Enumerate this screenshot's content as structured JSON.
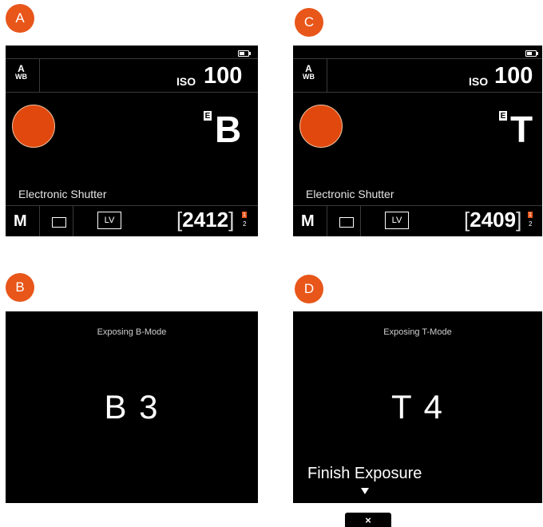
{
  "panels": {
    "A": {
      "badge": "A",
      "wb_top": "A",
      "wb_bottom": "WB",
      "iso_label": "ISO",
      "iso_value": "100",
      "e_marker": "E",
      "mode": "B",
      "shutter_text": "Electronic Shutter",
      "exposure_mode": "M",
      "lv_label": "LV",
      "bracket_open": "[",
      "shot_count": "2412",
      "bracket_close": "]",
      "card_slot_active": "1",
      "card_slot_other": "2"
    },
    "C": {
      "badge": "C",
      "wb_top": "A",
      "wb_bottom": "WB",
      "iso_label": "ISO",
      "iso_value": "100",
      "e_marker": "E",
      "mode": "T",
      "shutter_text": "Electronic Shutter",
      "exposure_mode": "M",
      "lv_label": "LV",
      "bracket_open": "[",
      "shot_count": "2409",
      "bracket_close": "]",
      "card_slot_active": "1",
      "card_slot_other": "2"
    },
    "B": {
      "badge": "B",
      "title": "Exposing B-Mode",
      "readout": "B 3"
    },
    "D": {
      "badge": "D",
      "title": "Exposing T-Mode",
      "readout": "T 4",
      "finish_label": "Finish Exposure",
      "close_glyph": "×"
    }
  },
  "colors": {
    "accent": "#e8561a",
    "record_button": "#e0480e",
    "screen_bg": "#000000",
    "divider": "#3a3a3a"
  },
  "icons": {
    "battery": "battery-icon",
    "frame": "single-frame-icon",
    "record": "record-button",
    "arrow": "down-arrow-icon",
    "close": "close-icon"
  }
}
